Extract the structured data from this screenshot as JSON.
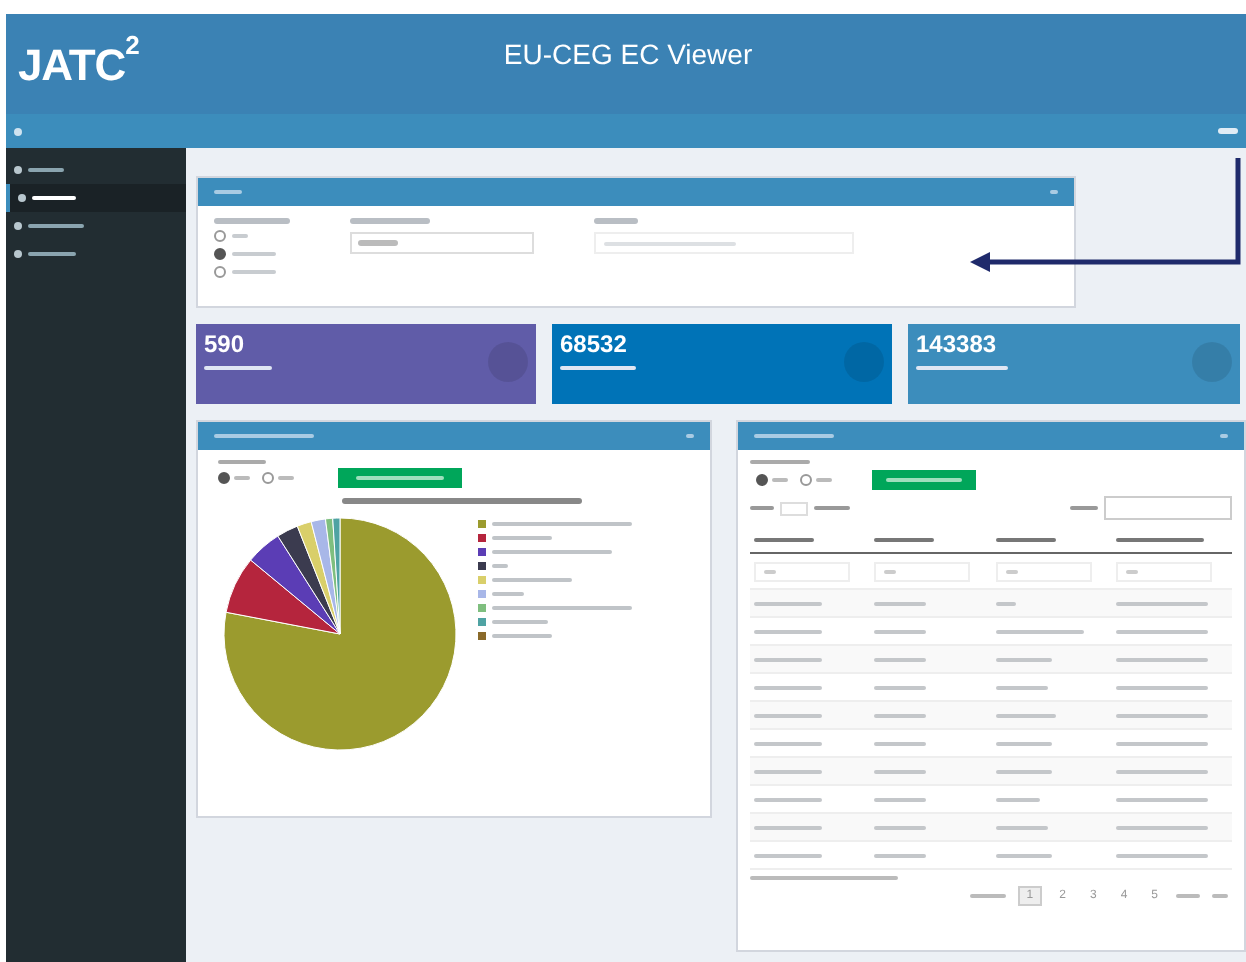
{
  "header": {
    "logo": "JATC",
    "logo_superscript": "2",
    "title": "EU-CEG EC Viewer"
  },
  "sidebar": {
    "items": [
      {
        "selected": false
      },
      {
        "selected": true
      },
      {
        "selected": false
      },
      {
        "selected": false
      }
    ]
  },
  "filters": {
    "radios": [
      {
        "selected": false
      },
      {
        "selected": true
      },
      {
        "selected": false
      }
    ]
  },
  "stats": [
    {
      "value": "590",
      "color": "#605ca8"
    },
    {
      "value": "68532",
      "color": "#0073b7"
    },
    {
      "value": "143383",
      "color": "#3c8dbc"
    }
  ],
  "pie_panel": {
    "radios": [
      {
        "selected": true
      },
      {
        "selected": false
      }
    ]
  },
  "table_panel": {
    "radios": [
      {
        "selected": true
      },
      {
        "selected": false
      }
    ],
    "pages": [
      {
        "label": "1",
        "selected": true
      },
      {
        "label": "2",
        "selected": false
      },
      {
        "label": "3",
        "selected": false
      },
      {
        "label": "4",
        "selected": false
      },
      {
        "label": "5",
        "selected": false
      }
    ]
  }
}
